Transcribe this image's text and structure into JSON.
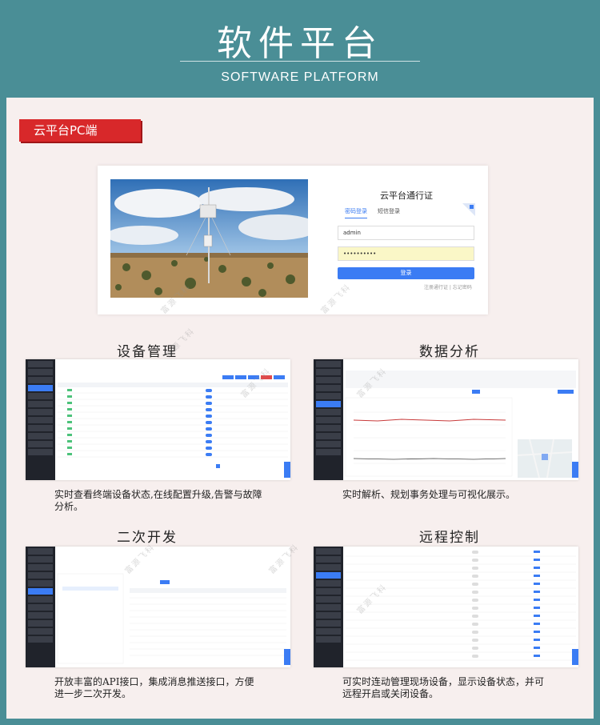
{
  "header": {
    "title": "软件平台",
    "subtitle": "SOFTWARE PLATFORM"
  },
  "badge": "云平台PC端",
  "login": {
    "title": "云平台通行证",
    "tab_password": "密码登录",
    "tab_sms": "短信登录",
    "username": "admin",
    "password": "••••••••••",
    "login_button": "登录",
    "links": "注册通行证  |  忘记密码"
  },
  "sections": [
    {
      "title": "设备管理",
      "desc": "实时查看终端设备状态,在线配置升级,告警与故障分析。"
    },
    {
      "title": "数据分析",
      "desc": "实时解析、规划事务处理与可视化展示。"
    },
    {
      "title": "二次开发",
      "desc": "开放丰富的API接口，集成消息推送接口，方便进一步二次开发。"
    },
    {
      "title": "远程控制",
      "desc": "可实时连动管理现场设备，显示设备状态，并可远程开启或关闭设备。"
    }
  ],
  "colors": {
    "background": "#4a8e96",
    "panel": "#f7efee",
    "badge": "#d8282a",
    "accent": "#3b7cf4"
  },
  "watermark": "富源飞科"
}
